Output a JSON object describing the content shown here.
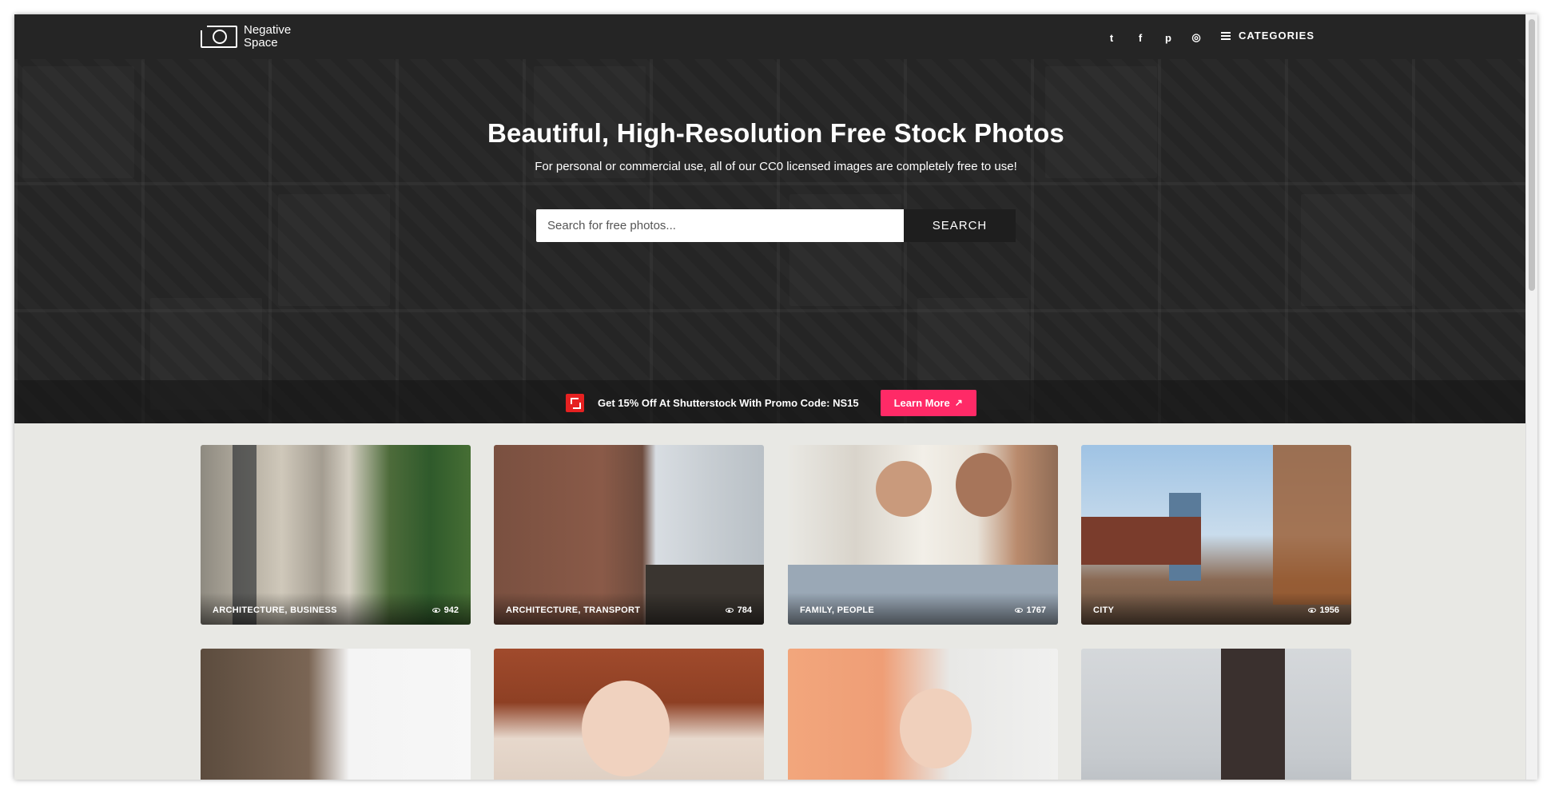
{
  "navbar": {
    "logo_text": "Negative Space",
    "social": [
      {
        "name": "twitter-icon",
        "glyph": "t"
      },
      {
        "name": "facebook-icon",
        "glyph": "f"
      },
      {
        "name": "pinterest-icon",
        "glyph": "p"
      },
      {
        "name": "instagram-icon",
        "glyph": "◎"
      }
    ],
    "categories_label": "CATEGORIES"
  },
  "hero": {
    "title": "Beautiful, High-Resolution Free Stock Photos",
    "subtitle": "For personal or commercial use, all of our CC0 licensed images are completely free to use!",
    "search_placeholder": "Search for free photos...",
    "search_button": "SEARCH"
  },
  "promo": {
    "text": "Get 15% Off At Shutterstock With Promo Code: NS15",
    "button": "Learn More"
  },
  "photos": [
    {
      "category": "ARCHITECTURE, BUSINESS",
      "views": "942"
    },
    {
      "category": "ARCHITECTURE, TRANSPORT",
      "views": "784"
    },
    {
      "category": "FAMILY, PEOPLE",
      "views": "1767"
    },
    {
      "category": "CITY",
      "views": "1956"
    },
    {
      "category": "",
      "views": ""
    },
    {
      "category": "",
      "views": ""
    },
    {
      "category": "",
      "views": ""
    },
    {
      "category": "",
      "views": ""
    }
  ],
  "colors": {
    "nav_bg": "#252525",
    "accent": "#ff2a67",
    "page_bg": "#e8e8e4"
  }
}
